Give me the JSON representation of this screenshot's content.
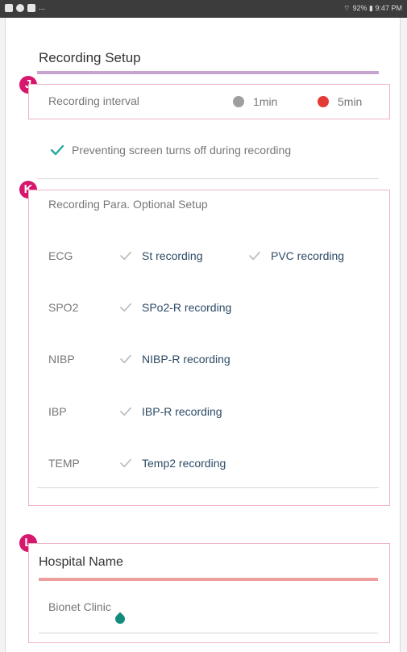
{
  "status_bar": {
    "right_text": "92% ▮ 9:47 PM",
    "left_overflow": "..."
  },
  "recording_setup": {
    "title": "Recording Setup",
    "badge_j": "J",
    "interval_label": "Recording interval",
    "options": [
      {
        "label": "1min",
        "selected": false
      },
      {
        "label": "5min",
        "selected": true
      }
    ],
    "prevent_label": "Preventing screen turns off during recording"
  },
  "optional_setup": {
    "badge_k": "K",
    "title": "Recording Para. Optional Setup",
    "rows": [
      {
        "param": "ECG",
        "options": [
          "St recording",
          "PVC recording"
        ]
      },
      {
        "param": "SPO2",
        "options": [
          "SPo2-R recording"
        ]
      },
      {
        "param": "NIBP",
        "options": [
          "NIBP-R recording"
        ]
      },
      {
        "param": "IBP",
        "options": [
          "IBP-R recording"
        ]
      },
      {
        "param": "TEMP",
        "options": [
          "Temp2 recording"
        ]
      }
    ]
  },
  "hospital": {
    "badge_l": "L",
    "title": "Hospital Name",
    "value": "Bionet Clinic"
  },
  "colors": {
    "badge": "#d7176d",
    "selected_radio": "#e53935",
    "checkmark_teal": "#26a8a0",
    "cursor": "#138b7c"
  }
}
